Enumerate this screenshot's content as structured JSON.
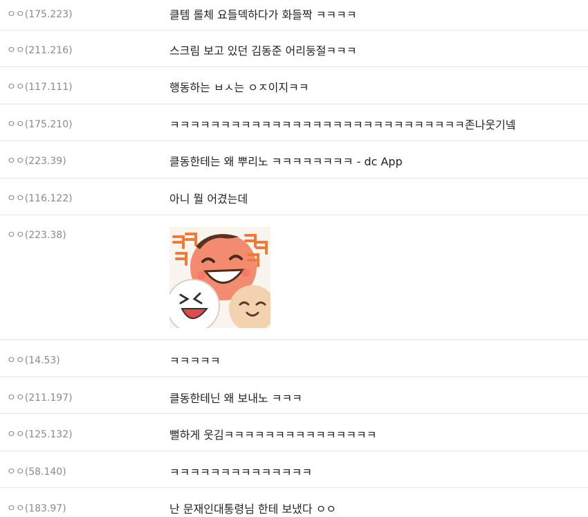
{
  "comments": [
    {
      "nick": "ㅇㅇ(175.223)",
      "text": "클템 롤체 요들덱하다가 화들짝 ㅋㅋㅋㅋ"
    },
    {
      "nick": "ㅇㅇ(211.216)",
      "text": "스크림 보고 있던 김동준 어리둥절ㅋㅋㅋ"
    },
    {
      "nick": "ㅇㅇ(117.111)",
      "text": "행동하는 ㅂㅅ는 ㅇㅈ이지ㅋㅋ"
    },
    {
      "nick": "ㅇㅇ(175.210)",
      "text": "ㅋㅋㅋㅋㅋㅋㅋㅋㅋㅋㅋㅋㅋㅋㅋㅋㅋㅋㅋㅋㅋㅋㅋㅋㅋㅋㅋㅋㅋ존나웃기넼"
    },
    {
      "nick": "ㅇㅇ(223.39)",
      "text": "클동한테는 왜 뿌리노 ㅋㅋㅋㅋㅋㅋㅋㅋ - dc App"
    },
    {
      "nick": "ㅇㅇ(116.122)",
      "text": "아니 뭘 어겼는데"
    },
    {
      "nick": "ㅇㅇ(223.38)",
      "text": "",
      "emoticon": "laughing-faces-emoticon"
    },
    {
      "nick": "ㅇㅇ(14.53)",
      "text": "ㅋㅋㅋㅋㅋ"
    },
    {
      "nick": "ㅇㅇ(211.197)",
      "text": "클동한테닌 왜 보내노 ㅋㅋㅋ"
    },
    {
      "nick": "ㅇㅇ(125.132)",
      "text": "뻘하게 웃김ㅋㅋㅋㅋㅋㅋㅋㅋㅋㅋㅋㅋㅋㅋㅋ"
    },
    {
      "nick": "ㅇㅇ(58.140)",
      "text": "ㅋㅋㅋㅋㅋㅋㅋㅋㅋㅋㅋㅋㅋㅋ"
    },
    {
      "nick": "ㅇㅇ(183.97)",
      "text": "난 문재인대통령님 한테 보냈다 ㅇㅇ"
    }
  ],
  "emoticon_colors": {
    "background": "#f9f4ee",
    "ka_text": "#ef7b3b",
    "face_main": "#f28b6f",
    "face_white": "#ffffff",
    "face_beige": "#f3d2b0"
  }
}
